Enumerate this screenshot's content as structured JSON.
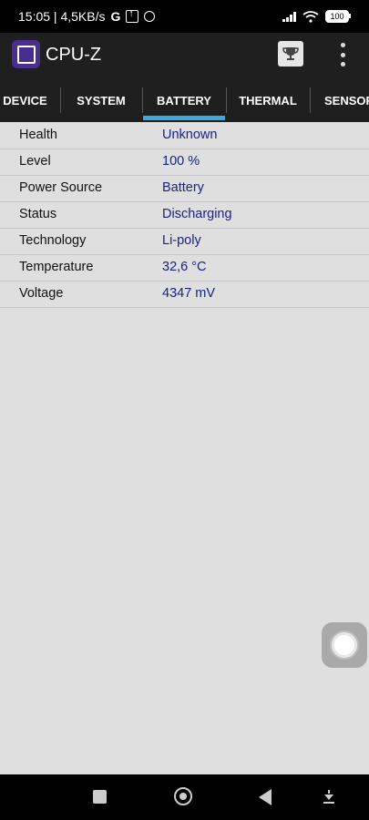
{
  "status_bar": {
    "time_speed": "15:05 | 4,5KB/s",
    "g_icon": "G",
    "battery_level": "100"
  },
  "app_bar": {
    "title": "CPU-Z",
    "icons": [
      "cpu-chip-icon",
      "trophy-icon",
      "overflow-menu-icon"
    ]
  },
  "tabs": [
    {
      "label": "DEVICE",
      "selected": false
    },
    {
      "label": "SYSTEM",
      "selected": false
    },
    {
      "label": "BATTERY",
      "selected": true
    },
    {
      "label": "THERMAL",
      "selected": false
    },
    {
      "label": "SENSORS",
      "selected": false
    }
  ],
  "colors": {
    "accent": "#3aa9e0",
    "value_text": "#1a237e",
    "background": "#dfdfdf",
    "app_bar": "#1f1f1f"
  },
  "battery": {
    "rows": [
      {
        "label": "Health",
        "value": "Unknown"
      },
      {
        "label": "Level",
        "value": "100 %"
      },
      {
        "label": "Power Source",
        "value": "Battery"
      },
      {
        "label": "Status",
        "value": "Discharging"
      },
      {
        "label": "Technology",
        "value": "Li-poly"
      },
      {
        "label": "Temperature",
        "value": "32,6 °C"
      },
      {
        "label": "Voltage",
        "value": "4347 mV"
      }
    ]
  }
}
